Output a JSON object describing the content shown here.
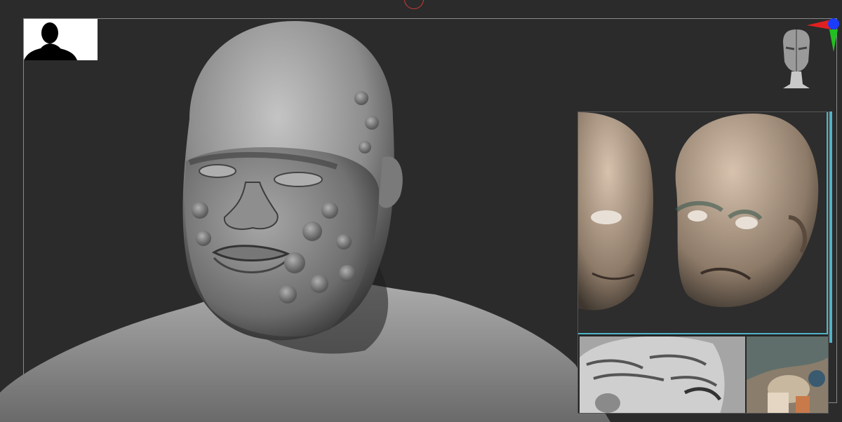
{
  "viewport": {
    "canvas_color": "#2b2b2b",
    "frame_color": "#8a8a8a"
  },
  "toolbar": {
    "silhouette_thumbnail": "silhouette-icon",
    "navigation_head": "navigation-head-icon",
    "axis_gizmo": "xyz-axis-icon"
  },
  "colors": {
    "axis_x": "#e02020",
    "axis_y": "#20c020",
    "axis_z": "#1a3cff",
    "panel_accent": "#4fb4c8",
    "clay": "#9a9a9a"
  },
  "reference_panel": {
    "images": [
      "old-man-head-front",
      "old-man-head-three-quarter",
      "wrinkled-head-closeup",
      "sculpt-photo-closeup"
    ]
  }
}
